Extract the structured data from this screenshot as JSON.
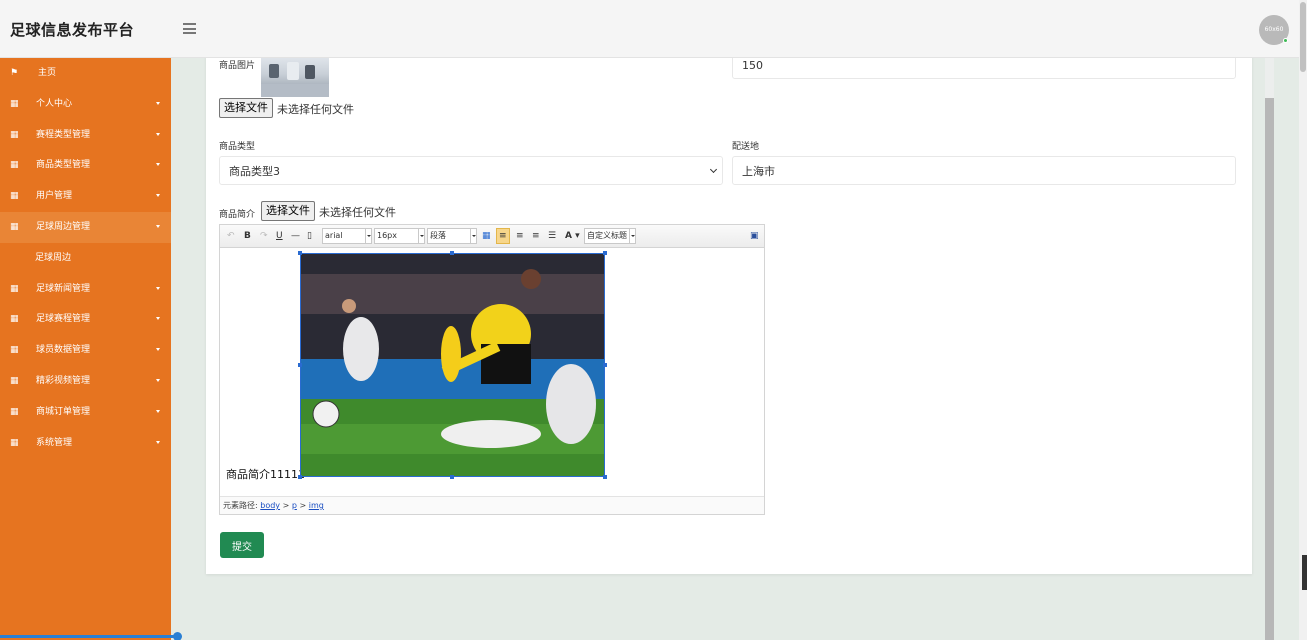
{
  "header": {
    "brand": "足球信息发布平台",
    "avatar_text": "60x60"
  },
  "sidebar": {
    "items": [
      {
        "label": "主页",
        "has_caret": false
      },
      {
        "label": "个人中心",
        "has_caret": true
      },
      {
        "label": "赛程类型管理",
        "has_caret": true
      },
      {
        "label": "商品类型管理",
        "has_caret": true
      },
      {
        "label": "用户管理",
        "has_caret": true
      },
      {
        "label": "足球周边管理",
        "has_caret": true,
        "active": true
      },
      {
        "label": "足球周边",
        "sub": true
      },
      {
        "label": "足球新闻管理",
        "has_caret": true
      },
      {
        "label": "足球赛程管理",
        "has_caret": true
      },
      {
        "label": "球员数据管理",
        "has_caret": true
      },
      {
        "label": "精彩视频管理",
        "has_caret": true
      },
      {
        "label": "商城订单管理",
        "has_caret": true
      },
      {
        "label": "系统管理",
        "has_caret": true
      }
    ]
  },
  "form": {
    "image_label": "商品图片",
    "price_value": "150",
    "file_button": "选择文件",
    "file_none": "未选择任何文件",
    "type_label": "商品类型",
    "type_value": "商品类型3",
    "delivery_label": "配送地",
    "delivery_value": "上海市",
    "intro_label": "商品简介",
    "submit_label": "提交"
  },
  "editor": {
    "font_family": "arial",
    "font_size": "16px",
    "paragraph": "段落",
    "custom_title": "自定义标题",
    "content_text": "商品简介11111",
    "path_label": "元素路径:",
    "path": [
      "body",
      "p",
      "img"
    ]
  },
  "colors": {
    "sidebar": "#e67420",
    "submit": "#218a52",
    "selection": "#2a6bd1"
  }
}
